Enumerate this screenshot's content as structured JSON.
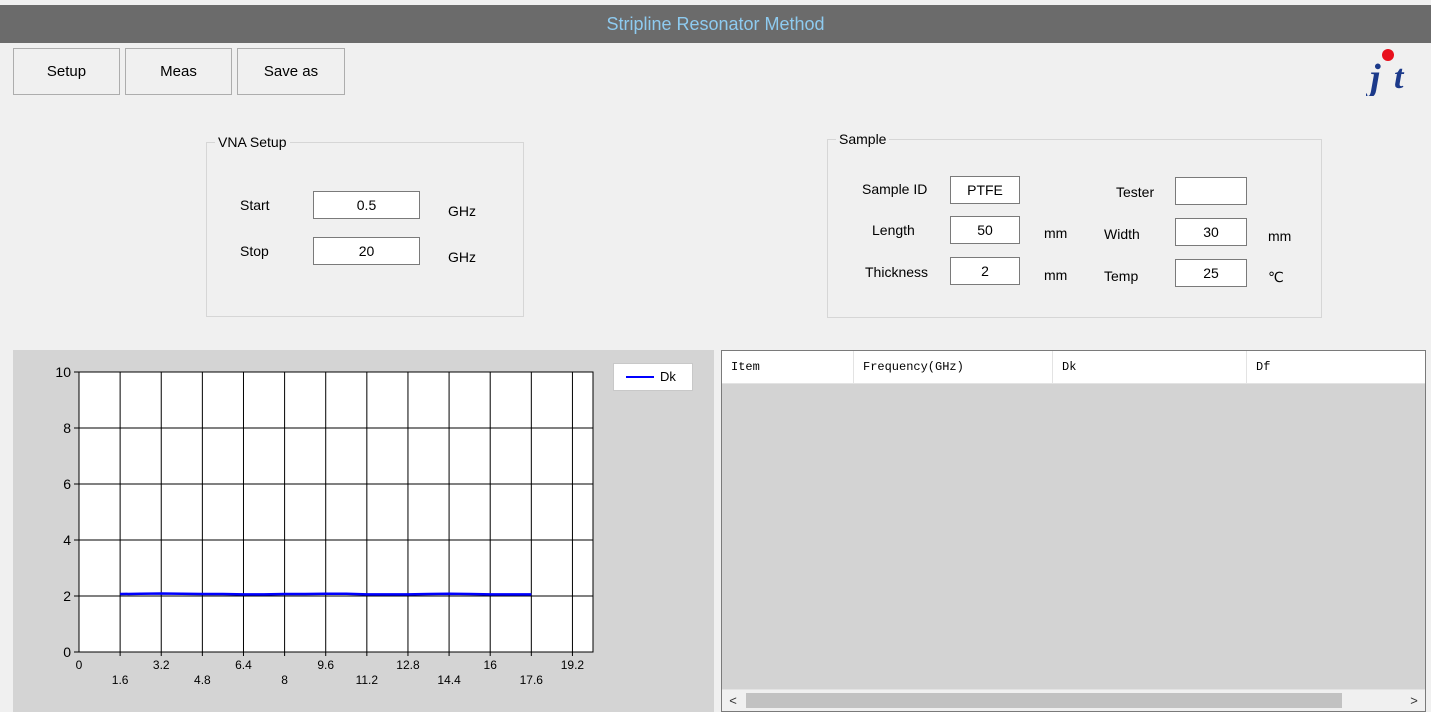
{
  "window": {
    "title": "Stripline Resonator Method"
  },
  "toolbar": {
    "setup_label": "Setup",
    "meas_label": "Meas",
    "saveas_label": "Save as"
  },
  "vna_setup": {
    "title": "VNA Setup",
    "start_label": "Start",
    "start_value": "0.5",
    "start_unit": "GHz",
    "stop_label": "Stop",
    "stop_value": "20",
    "stop_unit": "GHz"
  },
  "sample": {
    "title": "Sample",
    "id_label": "Sample ID",
    "id_value": "PTFE",
    "tester_label": "Tester",
    "tester_value": "",
    "length_label": "Length",
    "length_value": "50",
    "length_unit": "mm",
    "width_label": "Width",
    "width_value": "30",
    "width_unit": "mm",
    "thickness_label": "Thickness",
    "thickness_value": "2",
    "thickness_unit": "mm",
    "temp_label": "Temp",
    "temp_value": "25",
    "temp_unit": "℃"
  },
  "chart_data": {
    "type": "line",
    "ylim": [
      0,
      10
    ],
    "xlim": [
      0,
      20
    ],
    "yticks": [
      "0",
      "2",
      "4",
      "6",
      "8",
      "10"
    ],
    "xticks_top": [
      "0",
      "3.2",
      "6.4",
      "9.6",
      "12.8",
      "16",
      "19.2"
    ],
    "xticks_bottom": [
      "1.6",
      "4.8",
      "8",
      "11.2",
      "14.4",
      "17.6"
    ],
    "grid": true,
    "legend": "top-right",
    "series": [
      {
        "name": "Dk",
        "color": "#0000ff",
        "x": [
          1.6,
          2.4,
          3.2,
          4.0,
          4.8,
          5.6,
          6.4,
          7.2,
          8.0,
          8.8,
          9.6,
          10.4,
          11.2,
          12.0,
          12.8,
          13.6,
          14.4,
          15.2,
          16.0,
          16.8,
          17.6
        ],
        "values": [
          2.07,
          2.08,
          2.09,
          2.08,
          2.07,
          2.07,
          2.06,
          2.06,
          2.07,
          2.07,
          2.08,
          2.08,
          2.06,
          2.06,
          2.06,
          2.07,
          2.08,
          2.07,
          2.06,
          2.06,
          2.06
        ]
      }
    ]
  },
  "results_table": {
    "columns": [
      "Item",
      "Frequency(GHz)",
      "Dk",
      "Df"
    ],
    "rows": [],
    "scroll_left_icon": "<",
    "scroll_right_icon": ">"
  },
  "logo": {
    "text": "jt",
    "colors": {
      "dot": "#e8101c",
      "letters": "#1c3a8a"
    }
  }
}
